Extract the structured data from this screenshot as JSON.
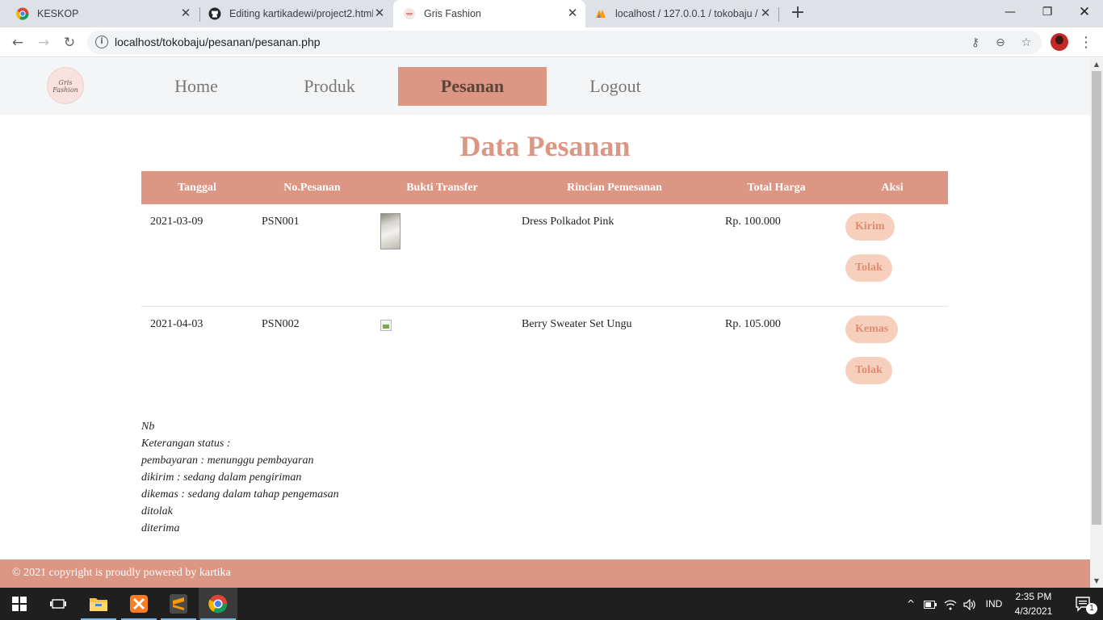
{
  "browser": {
    "tabs": [
      {
        "title": "KESKOP",
        "icon": "chrome-app-icon",
        "active": false
      },
      {
        "title": "Editing kartikadewi/project2.html",
        "icon": "github-icon",
        "active": false
      },
      {
        "title": "Gris Fashion",
        "icon": "gris-fashion-icon",
        "active": true
      },
      {
        "title": "localhost / 127.0.0.1 / tokobaju / ",
        "icon": "phpmyadmin-icon",
        "active": false
      }
    ],
    "url": "localhost/tokobaju/pesanan/pesanan.php"
  },
  "site": {
    "logo_text_1": "Gris",
    "logo_text_2": "Fashion",
    "nav": [
      {
        "label": "Home",
        "active": false
      },
      {
        "label": "Produk",
        "active": false
      },
      {
        "label": "Pesanan",
        "active": true
      },
      {
        "label": "Logout",
        "active": false
      }
    ]
  },
  "page": {
    "title": "Data Pesanan",
    "table": {
      "headers": [
        "Tanggal",
        "No.Pesanan",
        "Bukti Transfer",
        "Rincian Pemesanan",
        "Total Harga",
        "Aksi"
      ],
      "rows": [
        {
          "tanggal": "2021-03-09",
          "no": "PSN001",
          "bukti": "photo",
          "rincian": "Dress Polkadot Pink",
          "total": "Rp. 100.000",
          "actions": [
            "Kirim",
            "Tolak"
          ]
        },
        {
          "tanggal": "2021-04-03",
          "no": "PSN002",
          "bukti": "broken",
          "rincian": "Berry Sweater Set Ungu",
          "total": "Rp. 105.000",
          "actions": [
            "Kemas",
            "Tolak"
          ]
        }
      ]
    },
    "notes": [
      "Nb",
      "Keterangan status :",
      "pembayaran : menunggu pembayaran",
      "dikirim : sedang dalam pengiriman",
      "dikemas : sedang dalam tahap pengemasan",
      "ditolak",
      "diterima"
    ],
    "footer": "© 2021 copyright is proudly powered by kartika"
  },
  "taskbar": {
    "language": "IND",
    "time": "2:35 PM",
    "date": "4/3/2021",
    "notification_count": "1"
  },
  "colors": {
    "accent": "#db9684",
    "button_bg": "#f6cfbd",
    "button_text": "#e08c70"
  }
}
